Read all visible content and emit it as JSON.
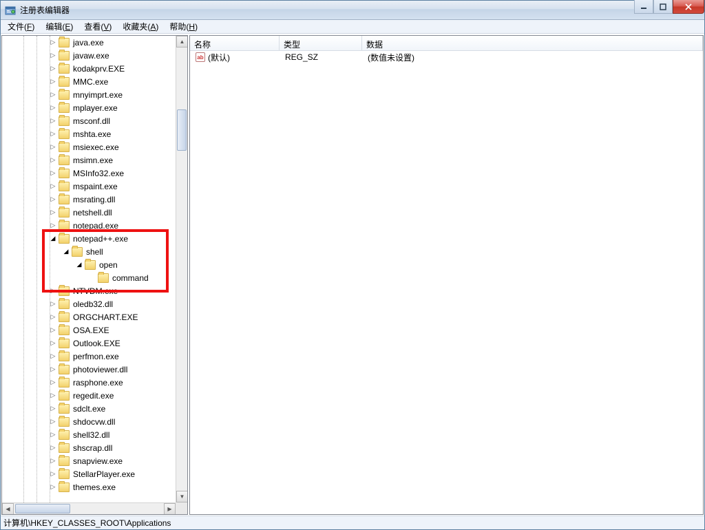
{
  "window": {
    "title": "注册表编辑器"
  },
  "menu": {
    "file": "文件(",
    "file_u": "F",
    "file_end": ")",
    "edit": "编辑(",
    "edit_u": "E",
    "edit_end": ")",
    "view": "查看(",
    "view_u": "V",
    "view_end": ")",
    "fav": "收藏夹(",
    "fav_u": "A",
    "fav_end": ")",
    "help": "帮助(",
    "help_u": "H",
    "help_end": ")"
  },
  "tree": {
    "items": [
      {
        "indent": 82,
        "exp": "▷",
        "label": "java.exe"
      },
      {
        "indent": 82,
        "exp": "▷",
        "label": "javaw.exe"
      },
      {
        "indent": 82,
        "exp": "▷",
        "label": "kodakprv.EXE"
      },
      {
        "indent": 82,
        "exp": "▷",
        "label": "MMC.exe"
      },
      {
        "indent": 82,
        "exp": "▷",
        "label": "mnyimprt.exe"
      },
      {
        "indent": 82,
        "exp": "▷",
        "label": "mplayer.exe"
      },
      {
        "indent": 82,
        "exp": "▷",
        "label": "msconf.dll"
      },
      {
        "indent": 82,
        "exp": "▷",
        "label": "mshta.exe"
      },
      {
        "indent": 82,
        "exp": "▷",
        "label": "msiexec.exe"
      },
      {
        "indent": 82,
        "exp": "▷",
        "label": "msimn.exe"
      },
      {
        "indent": 82,
        "exp": "▷",
        "label": "MSInfo32.exe"
      },
      {
        "indent": 82,
        "exp": "▷",
        "label": "mspaint.exe"
      },
      {
        "indent": 82,
        "exp": "▷",
        "label": "msrating.dll"
      },
      {
        "indent": 82,
        "exp": "▷",
        "label": "netshell.dll"
      },
      {
        "indent": 82,
        "exp": "▷",
        "label": "notepad.exe"
      },
      {
        "indent": 82,
        "exp": "◢",
        "label": "notepad++.exe"
      },
      {
        "indent": 101,
        "exp": "◢",
        "label": "shell"
      },
      {
        "indent": 120,
        "exp": "◢",
        "label": "open"
      },
      {
        "indent": 139,
        "exp": "",
        "label": "command"
      },
      {
        "indent": 82,
        "exp": "▷",
        "label": "NTVDM.exe"
      },
      {
        "indent": 82,
        "exp": "▷",
        "label": "oledb32.dll"
      },
      {
        "indent": 82,
        "exp": "▷",
        "label": "ORGCHART.EXE"
      },
      {
        "indent": 82,
        "exp": "▷",
        "label": "OSA.EXE"
      },
      {
        "indent": 82,
        "exp": "▷",
        "label": "Outlook.EXE"
      },
      {
        "indent": 82,
        "exp": "▷",
        "label": "perfmon.exe"
      },
      {
        "indent": 82,
        "exp": "▷",
        "label": "photoviewer.dll"
      },
      {
        "indent": 82,
        "exp": "▷",
        "label": "rasphone.exe"
      },
      {
        "indent": 82,
        "exp": "▷",
        "label": "regedit.exe"
      },
      {
        "indent": 82,
        "exp": "▷",
        "label": "sdclt.exe"
      },
      {
        "indent": 82,
        "exp": "▷",
        "label": "shdocvw.dll"
      },
      {
        "indent": 82,
        "exp": "▷",
        "label": "shell32.dll"
      },
      {
        "indent": 82,
        "exp": "▷",
        "label": "shscrap.dll"
      },
      {
        "indent": 82,
        "exp": "▷",
        "label": "snapview.exe"
      },
      {
        "indent": 82,
        "exp": "▷",
        "label": "StellarPlayer.exe"
      },
      {
        "indent": 82,
        "exp": "▷",
        "label": "themes.exe"
      }
    ]
  },
  "list": {
    "header": {
      "name": "名称",
      "type": "类型",
      "data": "数据"
    },
    "rows": [
      {
        "name": "(默认)",
        "type": "REG_SZ",
        "data": "(数值未设置)"
      }
    ]
  },
  "status": {
    "path": "计算机\\HKEY_CLASSES_ROOT\\Applications"
  },
  "icons": {
    "ab": "ab"
  }
}
